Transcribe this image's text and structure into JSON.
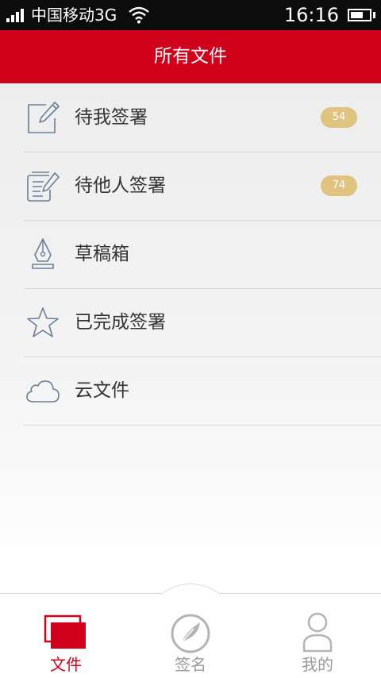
{
  "status_bar": {
    "carrier": "中国移动3G",
    "time": "16:16",
    "battery_level": 0.7
  },
  "header": {
    "title": "所有文件"
  },
  "menu": {
    "items": [
      {
        "label": "待我签署",
        "icon": "edit-document-icon",
        "badge": "54"
      },
      {
        "label": "待他人签署",
        "icon": "document-list-pen-icon",
        "badge": "74"
      },
      {
        "label": "草稿箱",
        "icon": "fountain-pen-icon"
      },
      {
        "label": "已完成签署",
        "icon": "star-icon"
      },
      {
        "label": "云文件",
        "icon": "cloud-icon"
      }
    ]
  },
  "tabs": [
    {
      "label": "文件",
      "icon": "files-icon",
      "active": true
    },
    {
      "label": "签名",
      "icon": "quill-sign-icon",
      "active": false
    },
    {
      "label": "我的",
      "icon": "user-icon",
      "active": false
    }
  ],
  "colors": {
    "brand": "#d0021b",
    "badge": "#e1c380",
    "icon": "#6a7f97",
    "tab_inactive": "#9a9a9a"
  }
}
